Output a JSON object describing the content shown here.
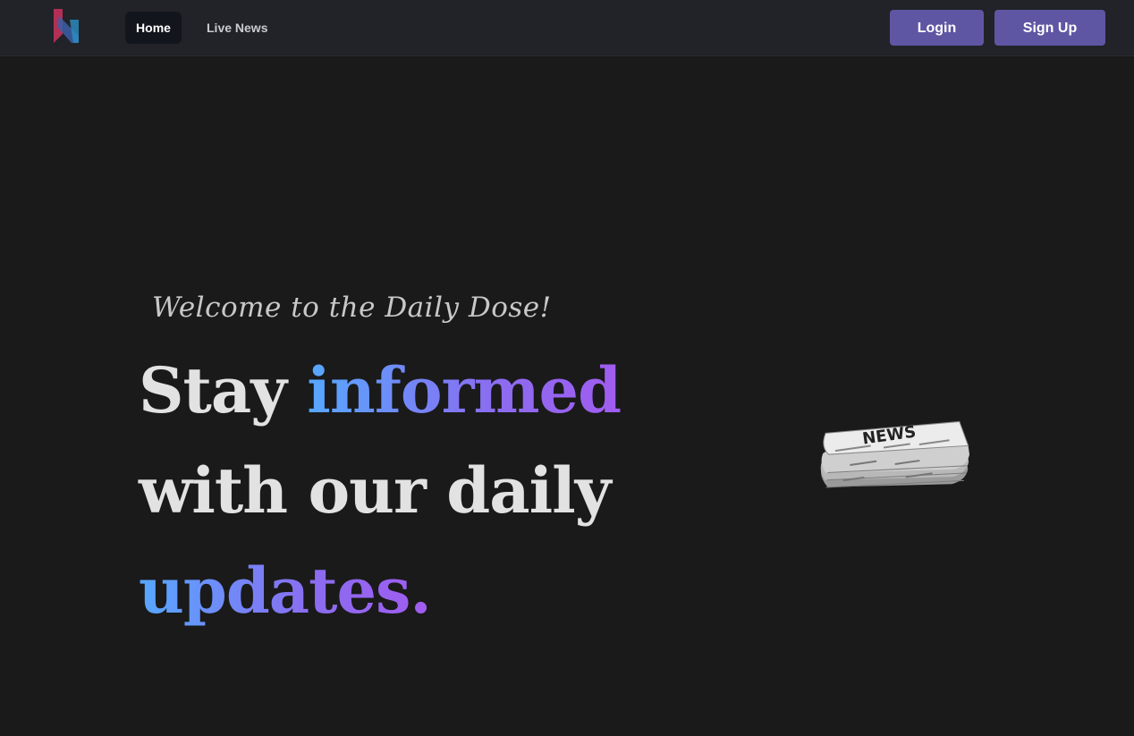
{
  "nav": {
    "home_label": "Home",
    "live_news_label": "Live News",
    "login_label": "Login",
    "signup_label": "Sign Up"
  },
  "hero": {
    "welcome": "Welcome to the Daily Dose!",
    "line1_plain": "Stay ",
    "line1_accent": "informed",
    "line2_plain": "with our daily",
    "line3_accent": "updates."
  },
  "illustration": {
    "masthead": "NEWS"
  },
  "colors": {
    "page_bg": "#1a1a1a",
    "navbar_bg": "#212328",
    "button_bg": "#5f56a3",
    "accent_gradient_start": "#56a8ff",
    "accent_gradient_end": "#a15cf0"
  }
}
